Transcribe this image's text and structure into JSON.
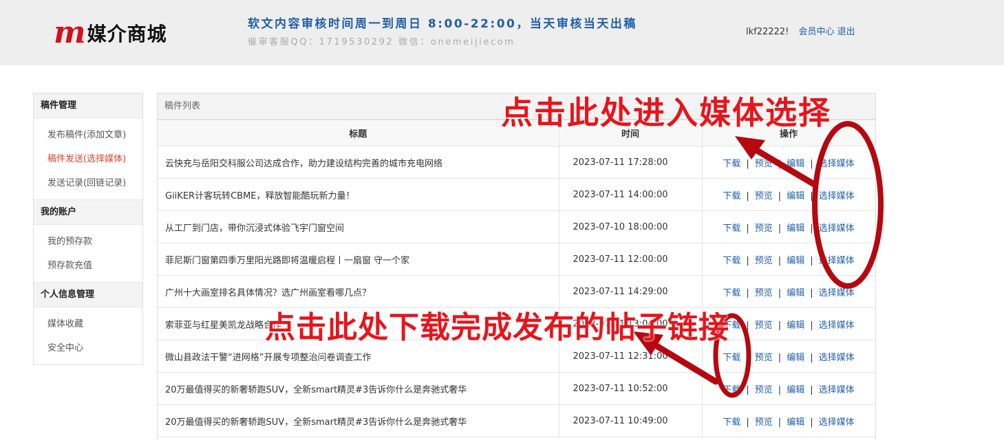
{
  "header": {
    "logo_mark": "m",
    "logo_text": "媒介商城",
    "notice_main": "软文内容审核时间周一到周日 8:00-22:00，当天审核当天出稿",
    "notice_sub": "催审客服QQ：1719530292 微信：onemeijiecom",
    "username": "lkf22222!",
    "member_center": "会员中心",
    "logout": "退出"
  },
  "sidebar": {
    "groups": [
      {
        "title": "稿件管理",
        "items": [
          "发布稿件(添加文章)",
          "稿件发送(选择媒体)",
          "发送记录(回链记录)"
        ]
      },
      {
        "title": "我的账户",
        "items": [
          "我的预存款",
          "预存款充值"
        ]
      },
      {
        "title": "个人信息管理",
        "items": [
          "媒体收藏",
          "安全中心"
        ]
      }
    ]
  },
  "panel": {
    "title": "稿件列表",
    "columns": [
      "标题",
      "时间",
      "操作"
    ],
    "ops": [
      "下载",
      "预览",
      "编辑",
      "选择媒体"
    ],
    "rows": [
      {
        "title": "云快充与岳阳交科服公司达成合作，助力建设结构完善的城市充电网络",
        "time": "2023-07-11 17:28:00"
      },
      {
        "title": "GiiKER计客玩转CBME，释放智能酷玩新力量！",
        "time": "2023-07-11 14:00:00"
      },
      {
        "title": "从工厂到门店，带你沉浸式体验飞宇门窗空间",
        "time": "2023-07-10 18:00:00"
      },
      {
        "title": "菲尼斯门窗第四季万里阳光路即将温暖启程丨一扇窗 守一个家",
        "time": "2023-07-11 12:00:00"
      },
      {
        "title": "广州十大画室排名具体情况？选广州画室看哪几点？",
        "time": "2023-07-11 14:29:00"
      },
      {
        "title": "索菲亚与红星美凯龙战略合作",
        "time": "2023-07-11 13:04:00"
      },
      {
        "title": "微山县政法干警“进网格”开展专项整治问卷调查工作",
        "time": "2023-07-11 12:31:00"
      },
      {
        "title": "20万最值得买的新奢轿跑SUV，全新smart精灵#3告诉你什么是奔驰式奢华",
        "time": "2023-07-11 10:52:00"
      },
      {
        "title": "20万最值得买的新奢轿跑SUV，全新smart精灵#3告诉你什么是奔驰式奢华",
        "time": "2023-07-11 10:49:00"
      }
    ]
  },
  "annotations": {
    "top": "点击此处进入媒体选择",
    "bottom": "点击此处下载完成发布的帖子链接"
  },
  "colors": {
    "accent": "#1f5fa8",
    "active": "#d9452d",
    "annotation": "#e8141b",
    "logo": "#d0121b"
  }
}
